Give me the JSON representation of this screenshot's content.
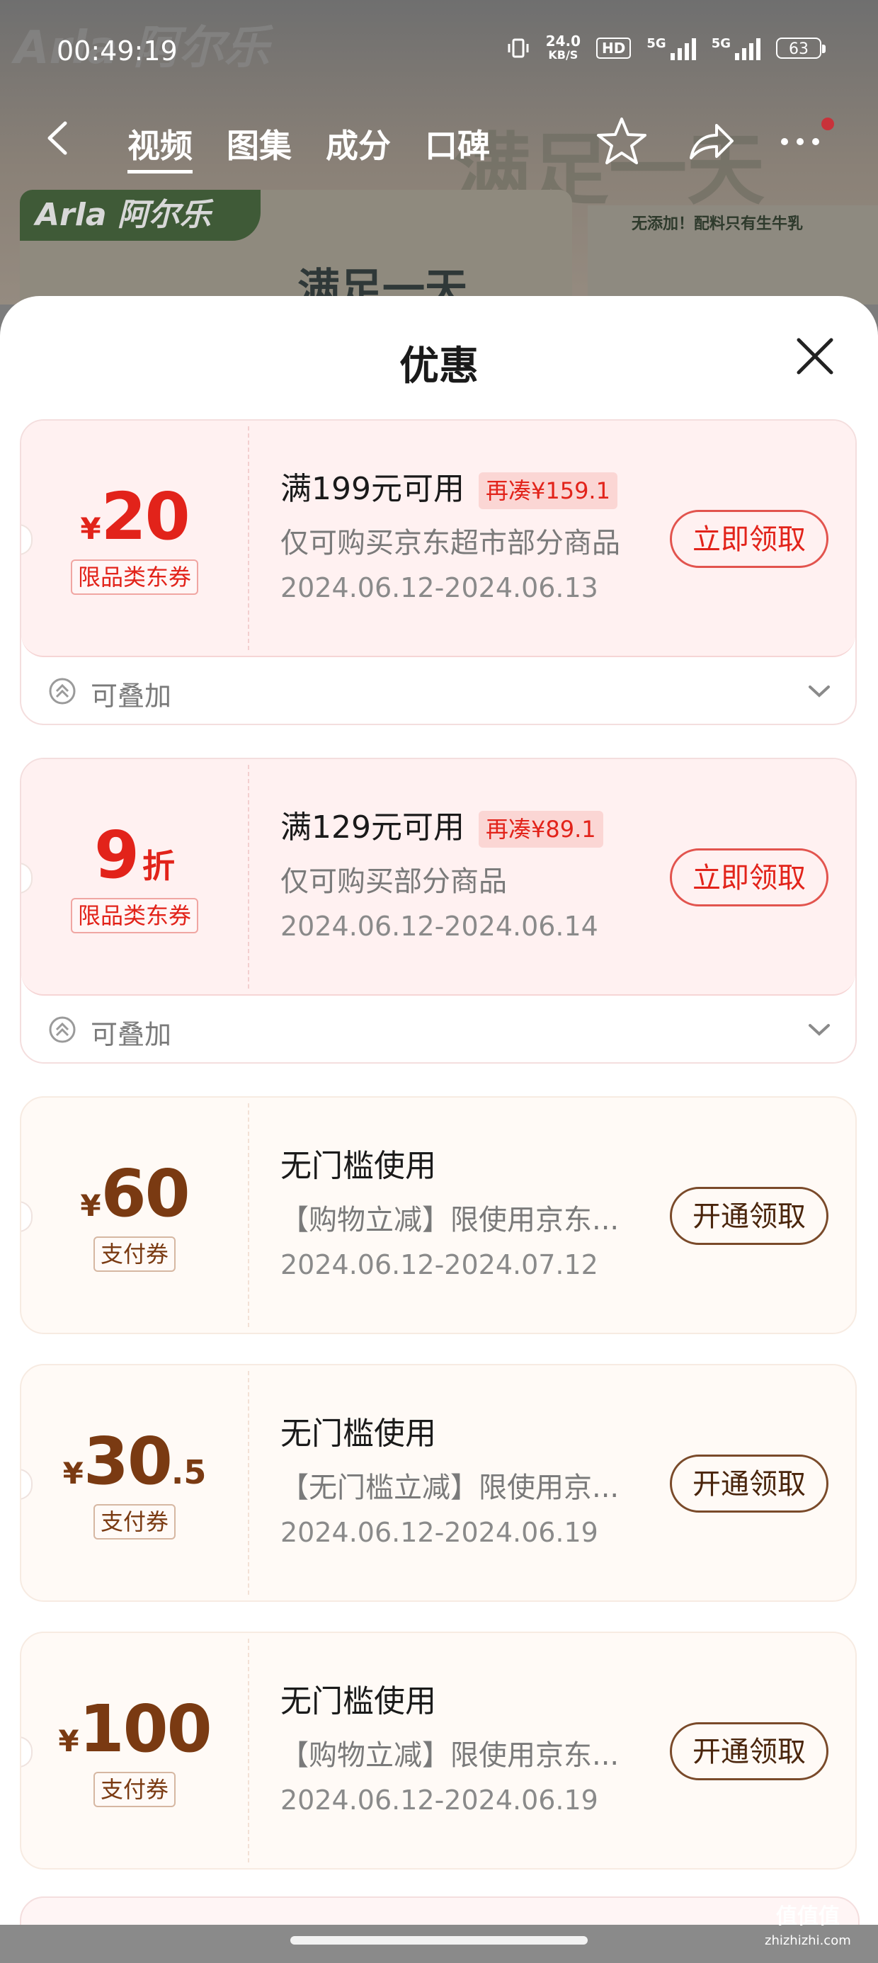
{
  "status_bar": {
    "time": "00:49:19",
    "net_speed_value": "24.0",
    "net_speed_unit": "KB/S",
    "hd_label": "HD",
    "signal1_label": "5G",
    "signal2_label": "5G",
    "battery": "63"
  },
  "background": {
    "brand_ghost": "Arla 阿尔乐",
    "logo_text": "Arla 阿尔乐",
    "right_text": "无添加！配料只有生牛乳",
    "slogan": "满足一天",
    "ghost_slogan": "满足一天"
  },
  "nav": {
    "tabs": [
      "视频",
      "图集",
      "成分",
      "口碑"
    ]
  },
  "sheet": {
    "title": "优惠"
  },
  "coupons": [
    {
      "currency": "¥",
      "amount": "20",
      "decimal": "",
      "unit": "",
      "tag": "限品类东券",
      "condition": "满199元可用",
      "topup": "再凑¥159.1",
      "scope": "仅可购买京东超市部分商品",
      "dates": "2024.06.12-2024.06.13",
      "button": "立即领取",
      "stack_label": "可叠加"
    },
    {
      "currency": "",
      "amount": "9",
      "decimal": "",
      "unit": "折",
      "tag": "限品类东券",
      "condition": "满129元可用",
      "topup": "再凑¥89.1",
      "scope": "仅可购买部分商品",
      "dates": "2024.06.12-2024.06.14",
      "button": "立即领取",
      "stack_label": "可叠加"
    },
    {
      "currency": "¥",
      "amount": "60",
      "decimal": "",
      "unit": "",
      "tag": "支付券",
      "condition": "无门槛使用",
      "topup": "",
      "scope": "【购物立减】限使用京东...",
      "dates": "2024.06.12-2024.07.12",
      "button": "开通领取"
    },
    {
      "currency": "¥",
      "amount": "30",
      "decimal": ".5",
      "unit": "",
      "tag": "支付券",
      "condition": "无门槛使用",
      "topup": "",
      "scope": "【无门槛立减】限使用京...",
      "dates": "2024.06.12-2024.06.19",
      "button": "开通领取"
    },
    {
      "currency": "¥",
      "amount": "100",
      "decimal": "",
      "unit": "",
      "tag": "支付券",
      "condition": "无门槛使用",
      "topup": "",
      "scope": "【购物立减】限使用京东...",
      "dates": "2024.06.12-2024.06.19",
      "button": "开通领取"
    }
  ],
  "watermark": {
    "title": "值值值",
    "domain": "zhizhizhi.com"
  },
  "colors": {
    "red_accent": "#e2231a",
    "gold_accent": "#7a3a12",
    "red_card_bg": "#fff1f1",
    "gold_card_bg": "#fffaf6"
  }
}
